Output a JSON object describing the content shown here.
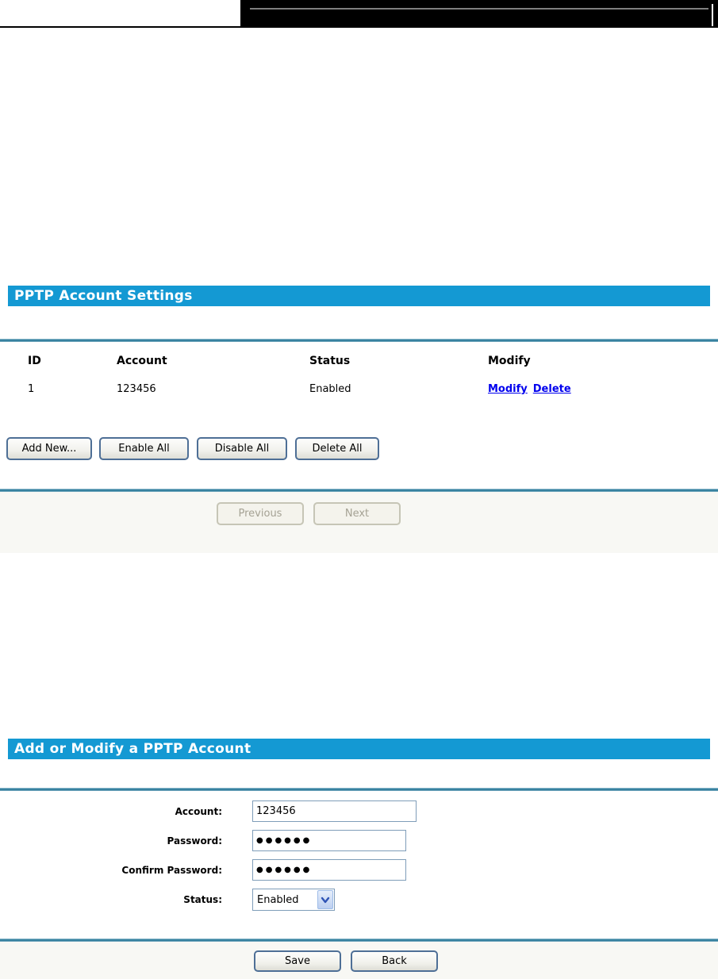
{
  "colors": {
    "section_bar_blue": "#1499D3",
    "separator_teal": "#35809E",
    "link_blue": "#0000EE",
    "disabled_text": "#A5A294",
    "input_border": "#7F9DB9"
  },
  "section_pptp": {
    "title": "PPTP Account Settings",
    "table": {
      "headers": [
        "ID",
        "Account",
        "Status",
        "Modify"
      ],
      "rows": [
        {
          "id": "1",
          "account": "123456",
          "status": "Enabled",
          "modify": "Modify",
          "delete": "Delete"
        }
      ]
    },
    "buttons": {
      "add_new": "Add New...",
      "enable_all": "Enable All",
      "disable_all": "Disable All",
      "delete_all": "Delete All"
    },
    "pagination": {
      "previous": "Previous",
      "next": "Next"
    }
  },
  "section_add": {
    "title": "Add or Modify a PPTP Account",
    "fields": {
      "account": {
        "label": "Account:",
        "value": "123456"
      },
      "password": {
        "label": "Password:",
        "value": "●●●●●●"
      },
      "confirm": {
        "label": "Confirm Password:",
        "value": "●●●●●●"
      },
      "status": {
        "label": "Status:",
        "value": "Enabled"
      }
    },
    "buttons": {
      "save": "Save",
      "back": "Back"
    }
  }
}
